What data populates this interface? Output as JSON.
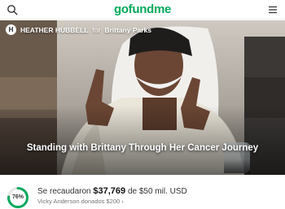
{
  "header": {
    "logo_text": "gofundme",
    "search_icon": "search-icon",
    "menu_icon": "hamburger-menu-icon",
    "brand_color": "#02a95c"
  },
  "hero": {
    "organizer_initial": "H",
    "organizer_name": "HEATHER HUBBELL",
    "for_text": "for",
    "beneficiary": "Brittany Parks",
    "title": "Standing with Brittany Through Her Cancer Journey",
    "slide_count": 5,
    "active_slide": 2
  },
  "progress": {
    "percent_label": "76%",
    "percent_value": 0.76,
    "raised_prefix": "Se recaudaron",
    "raised_amount": "$37,769",
    "goal_text": "de $50 mil. USD",
    "recent_donor": "Vicky Anderson donados $200",
    "accent_color": "#02a95c"
  }
}
